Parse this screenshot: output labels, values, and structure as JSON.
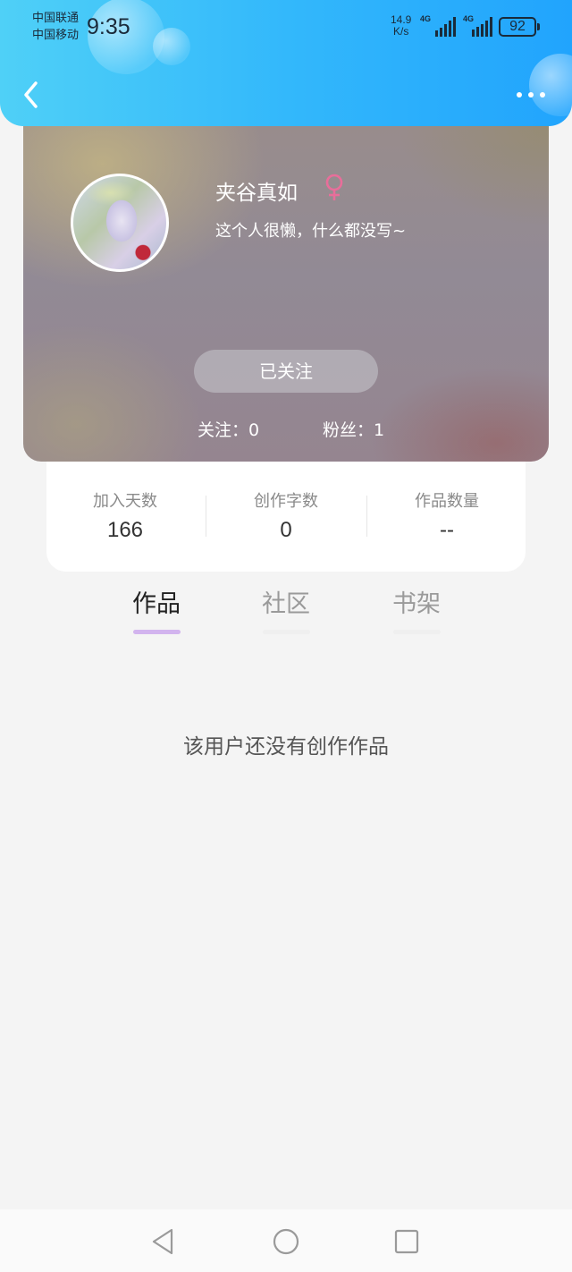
{
  "status_bar": {
    "carrier_1": "中国联通",
    "carrier_2": "中国移动",
    "time": "9:35",
    "net_speed_value": "14.9",
    "net_speed_unit": "K/s",
    "signal_1_label": "4G",
    "signal_2_label": "4G",
    "battery": "92"
  },
  "header": {
    "back_icon": "chevron-left-icon",
    "more_icon": "more-dots-icon"
  },
  "profile": {
    "username": "夹谷真如",
    "gender_icon": "female-icon",
    "gender_color": "#e86e9a",
    "bio": "这个人很懒，什么都没写~",
    "follow_button": "已关注",
    "following": "关注：0",
    "fans": "粉丝：1"
  },
  "stats": [
    {
      "label": "加入天数",
      "value": "166"
    },
    {
      "label": "创作字数",
      "value": "0"
    },
    {
      "label": "作品数量",
      "value": "--"
    }
  ],
  "tabs": [
    {
      "label": "作品",
      "active": true
    },
    {
      "label": "社区",
      "active": false
    },
    {
      "label": "书架",
      "active": false
    }
  ],
  "empty_message": "该用户还没有创作作品",
  "nav_bar": {
    "back": "triangle-back-icon",
    "home": "circle-home-icon",
    "recents": "square-recents-icon"
  },
  "colors": {
    "header_start": "#4fd0f7",
    "header_end": "#21a4fd",
    "active_tab_indicator": "#d2b4ee"
  }
}
